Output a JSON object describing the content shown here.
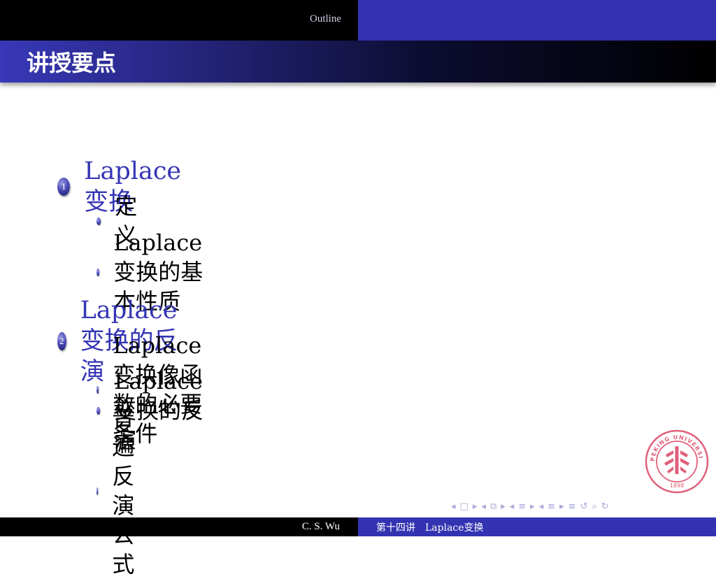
{
  "headline": {
    "section_label": "Outline"
  },
  "frame": {
    "title": "讲授要点"
  },
  "toc": {
    "sections": [
      {
        "number": "1",
        "title": "Laplace变换",
        "subsections": [
          "定义",
          "Laplace变换的基本性质"
        ]
      },
      {
        "number": "2",
        "title": "Laplace变换的反演",
        "subsections": [
          "Laplace变换像函数的必要条件",
          "Laplace变换的反演",
          "普遍反演公式"
        ]
      }
    ]
  },
  "logo": {
    "icon": "peking-university-seal-icon",
    "year": "1898",
    "color": "#e0607a"
  },
  "navigation": {
    "symbols": [
      "◂",
      "□",
      "▸",
      "◂",
      "⧉",
      "▸",
      "◂",
      "≡",
      "▸",
      "◂",
      "≡",
      "▸",
      "≡",
      "↺",
      "⌕",
      "↻"
    ]
  },
  "footer": {
    "author": "C. S. Wu",
    "title": "第十四讲　Laplace变换"
  },
  "colors": {
    "accent": "#3333b2",
    "title_bar": "#000000",
    "section_text": "#3535b5"
  }
}
